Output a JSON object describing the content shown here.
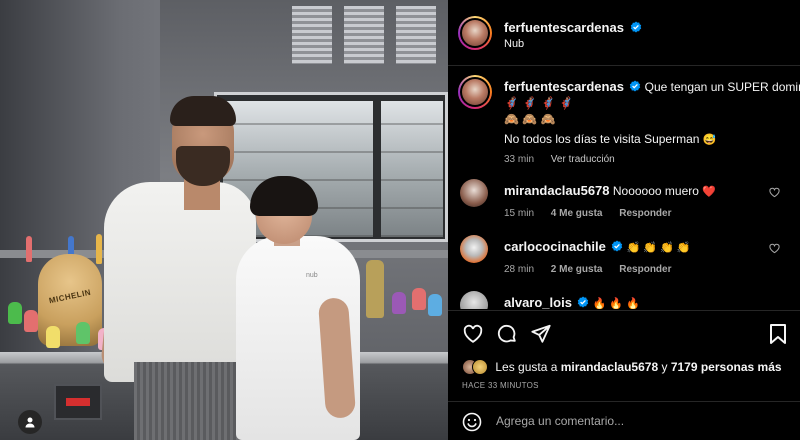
{
  "post": {
    "author": "ferfuentescardenas",
    "location": "Nub",
    "photo": {
      "mascot_text": "MICHELIN",
      "coat_logo": "nub"
    }
  },
  "caption": {
    "author": "ferfuentescardenas",
    "line1": "Que tengan un SUPER domingo",
    "emoji_row1": "🦸🏽‍♂️ 🦸🏽‍♂️ 🦸🏽‍♂️ 🦸🏽‍♂️",
    "emoji_row2": "🙈 🙈 🙈",
    "line2": "No todos los días te visita Superman",
    "line2_emoji": "😅",
    "time": "33 min",
    "translate": "Ver traducción"
  },
  "comments": [
    {
      "author": "mirandaclau5678",
      "text": "Noooooo muero",
      "emoji": "❤️",
      "time": "15 min",
      "likes": "4 Me gusta",
      "reply": "Responder"
    },
    {
      "author": "carlococinachile",
      "text": "",
      "emoji": "👏 👏 👏 👏",
      "time": "28 min",
      "likes": "2 Me gusta",
      "reply": "Responder"
    },
    {
      "author": "alvaro_lois",
      "text": "",
      "emoji": "🔥 🔥 🔥"
    }
  ],
  "likes": {
    "prefix": "Les gusta a",
    "user": "mirandaclau5678",
    "joiner": "y",
    "count": "7179 personas más"
  },
  "posted_ago": "HACE 33 MINUTOS",
  "composer": {
    "placeholder": "Agrega un comentario..."
  },
  "icons": {
    "like": "heart-icon",
    "comment": "comment-icon",
    "share": "share-icon",
    "save": "bookmark-icon",
    "emoji": "emoji-icon",
    "verified": "verified-badge-icon",
    "user": "user-icon"
  },
  "colors": {
    "background": "#000000",
    "text": "#f5f5f5",
    "muted": "#a8a8a8",
    "verified": "#0095f6",
    "heart": "#ff3040"
  }
}
